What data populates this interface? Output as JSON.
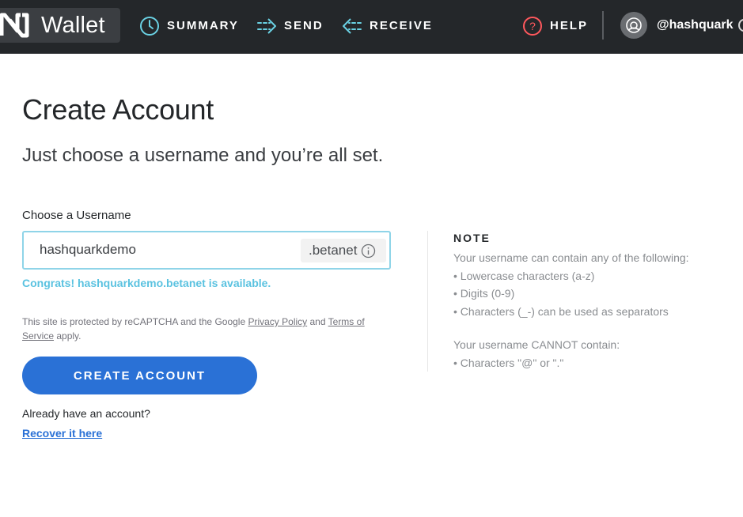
{
  "colors": {
    "topbar_bg": "#24272a",
    "accent_blue": "#2a71d6",
    "success_text": "#5ac2e0",
    "input_border": "#8fd4e8",
    "help_icon_red": "#ff585d"
  },
  "header": {
    "logo_text": "Wallet",
    "nav": [
      {
        "label": "SUMMARY",
        "icon": "clock-icon"
      },
      {
        "label": "SEND",
        "icon": "send-arrow-icon"
      },
      {
        "label": "RECEIVE",
        "icon": "receive-arrow-icon"
      },
      {
        "label": "HELP",
        "icon": "help-question-icon"
      }
    ],
    "account_name": "@hashquark",
    "account_icon": "user-avatar-icon"
  },
  "main": {
    "title": "Create Account",
    "subtitle": "Just choose a username and you’re all set.",
    "field_label": "Choose a Username",
    "username_value": "hashquarkdemo",
    "suffix": ".betanet",
    "info_icon": "info-icon",
    "success_message": "Congrats! hashquarkdemo.betanet is available.",
    "recaptcha": {
      "prefix": "This site is protected by reCAPTCHA and the Google ",
      "privacy_link": "Privacy Policy",
      "and": " and ",
      "terms_link": "Terms of Service",
      "suffix": " apply."
    },
    "create_button": "CREATE ACCOUNT",
    "already_text": "Already have an account?",
    "recover_link": "Recover it here"
  },
  "note": {
    "title": "NOTE",
    "can_intro": "Your username can contain any of the following:",
    "can_items": [
      "• Lowercase characters (a-z)",
      "• Digits (0-9)",
      "• Characters (_-) can be used as separators"
    ],
    "cannot_intro": "Your username CANNOT contain:",
    "cannot_items": [
      "• Characters \"@\" or \".\""
    ]
  }
}
